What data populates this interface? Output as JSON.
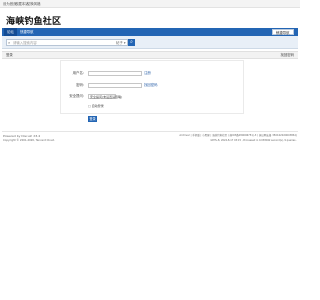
{
  "topbar": {
    "links": [
      "设为首页",
      "收藏本站",
      "切换风格"
    ]
  },
  "site": {
    "name": "海峡钓鱼社区"
  },
  "nav": {
    "items": [
      "论坛",
      "快捷导航"
    ],
    "quick_label": "快捷导航"
  },
  "search": {
    "placeholder": "请输入搜索内容",
    "type_label": "帖子",
    "type_arrow": "▾",
    "button_icon": "⌕"
  },
  "section": {
    "title": "登录",
    "right_link": "找回密码"
  },
  "form": {
    "username_label": "用户名:",
    "username_hint": "注册",
    "password_label": "密码:",
    "password_hint": "找回密码",
    "question_label": "安全提问:",
    "question_value": "安全提问(未设置请忽略)",
    "remember_label": "自动登录",
    "submit_label": "登录"
  },
  "footer": {
    "powered": "Powered by Discuz! X3.4",
    "copyright": "Copyright © 2001-2020, Tencent Cloud.",
    "links": "Archiver | 手机版 | 小黑屋 | 海峡钓鱼社区 ( 闽ICP备08009675号-3 ) 闽公网安备 35010202000386号",
    "timing": "GMT+8, 2024-8-17 03:15 , Processed in 0.038042 second(s), 9 queries ."
  }
}
